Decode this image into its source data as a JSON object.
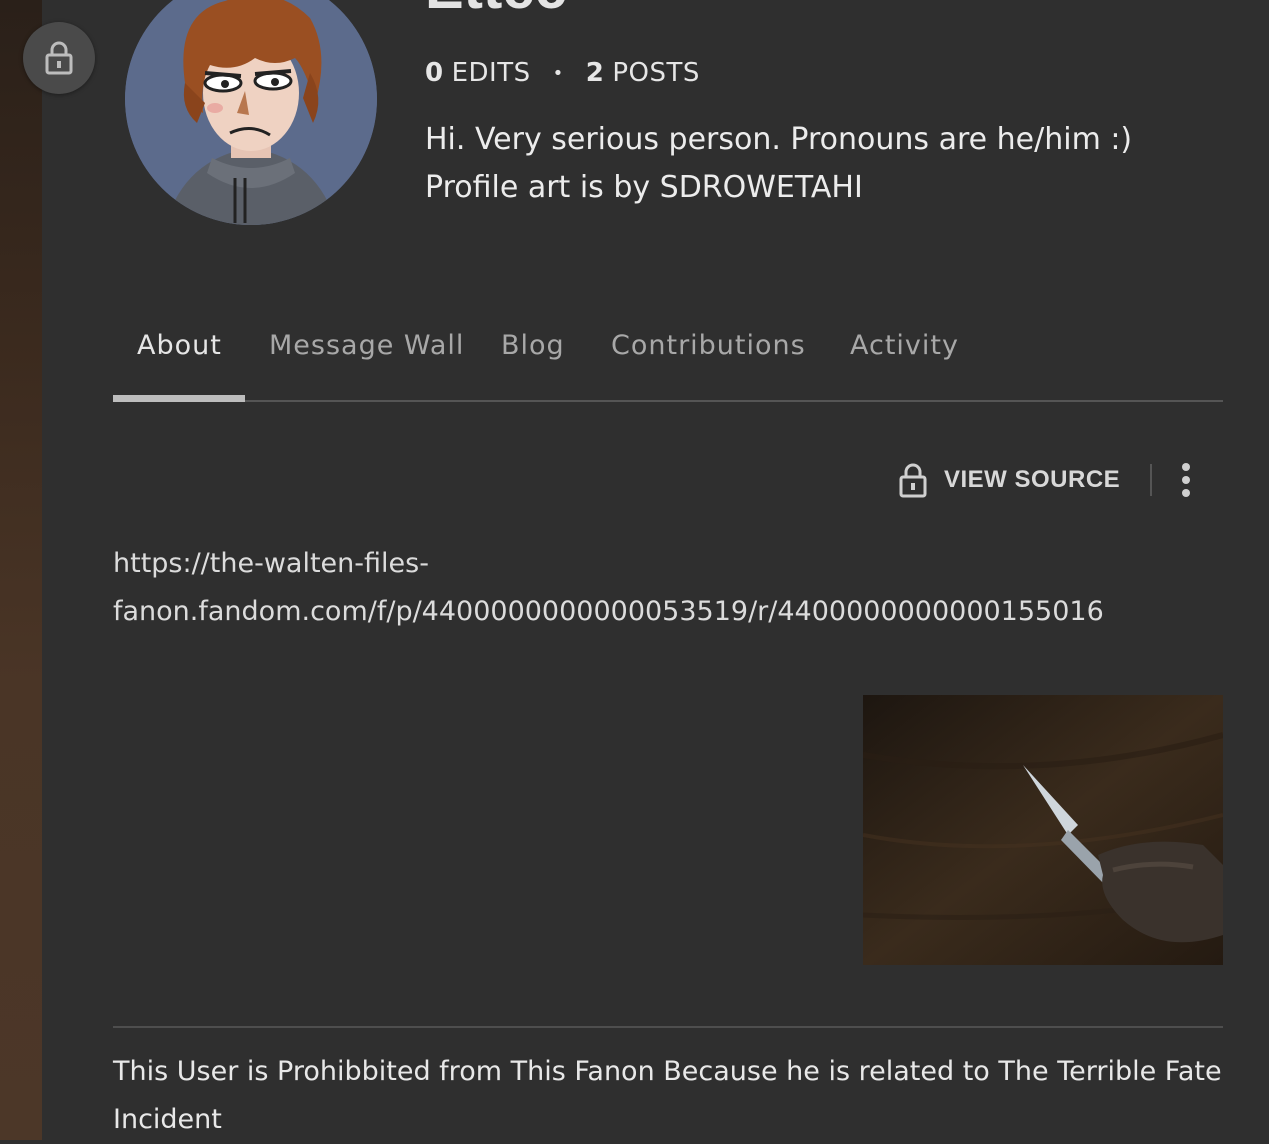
{
  "profile": {
    "username": "Ettec",
    "edits_count": "0",
    "edits_label": "EDITS",
    "separator": "•",
    "posts_count": "2",
    "posts_label": "POSTS",
    "bio_line1": "Hi. Very serious person. Pronouns are he/him :)",
    "bio_line2": "Profile art is by SDROWETAHI"
  },
  "tabs": [
    {
      "label": "About",
      "active": true
    },
    {
      "label": "Message Wall",
      "active": false
    },
    {
      "label": "Blog",
      "active": false
    },
    {
      "label": "Contributions",
      "active": false
    },
    {
      "label": "Activity",
      "active": false
    }
  ],
  "toolbar": {
    "view_source_label": "VIEW SOURCE"
  },
  "content": {
    "url_line1": "https://the-walten-files-",
    "url_line2": "fanon.fandom.com/f/p/4400000000000053519/r/4400000000000155016",
    "notice": "This User is Prohibbited from This Fanon Because he is related to The Terrible Fate Incident"
  },
  "icons": {
    "fab": "lock-icon",
    "view_source": "lock-icon",
    "more": "kebab-menu-icon"
  },
  "colors": {
    "background": "#2f2f2f",
    "text": "#e8e8e8",
    "muted_text": "#a8a8a8",
    "tab_underline": "#bdbdbd"
  }
}
